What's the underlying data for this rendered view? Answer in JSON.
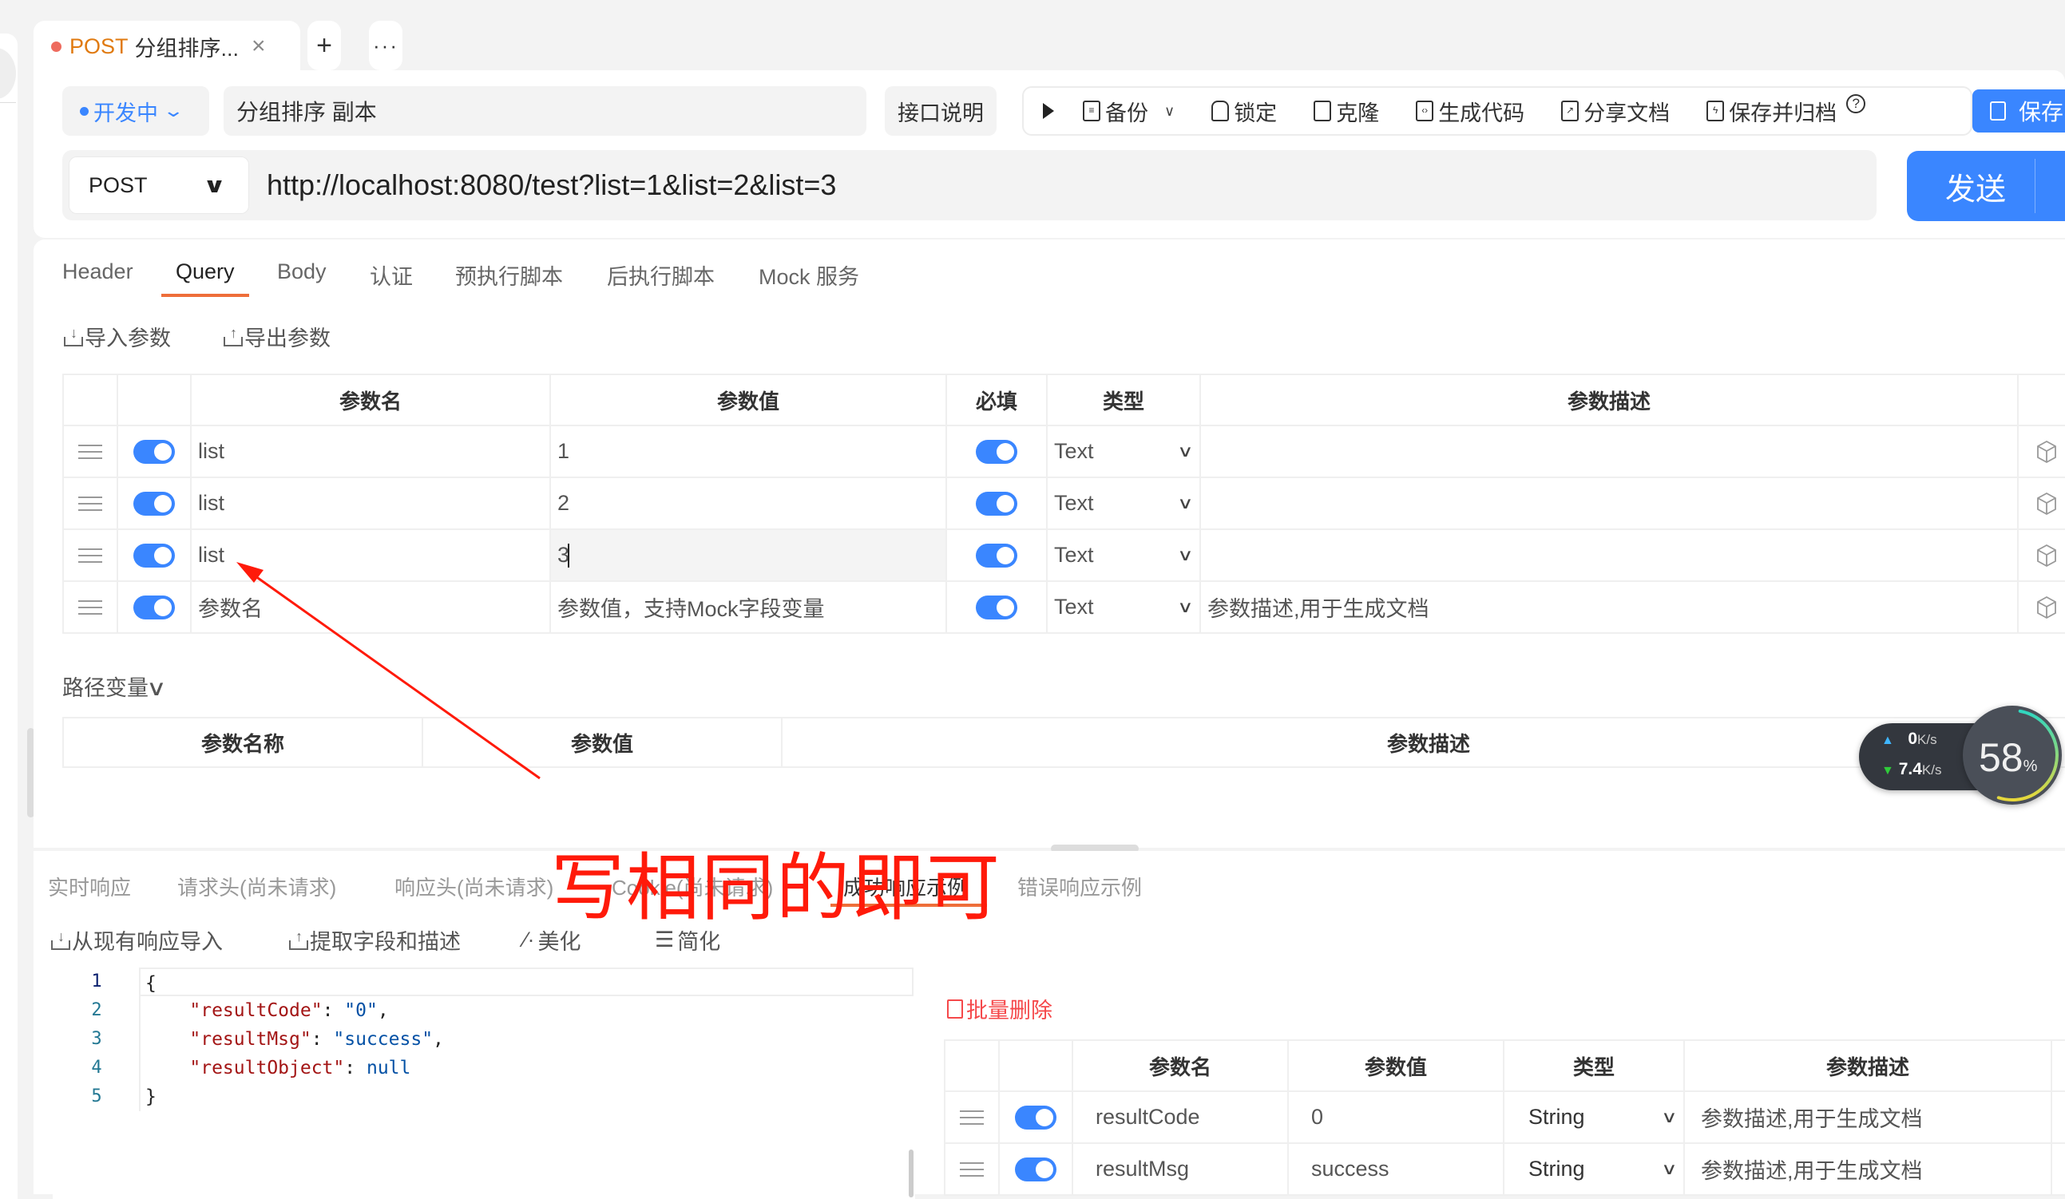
{
  "tab": {
    "method": "POST",
    "title": "分组排序...",
    "close_icon": "×",
    "add_label": "+",
    "more_label": "···"
  },
  "status": {
    "label": "开发中",
    "dot_color": "#3a86ff"
  },
  "api_name": "分组排序 副本",
  "doc_button": "接口说明",
  "toolbar": {
    "backup": "备份",
    "lock": "锁定",
    "clone": "克隆",
    "gen_code": "生成代码",
    "share_doc": "分享文档",
    "save_archive": "保存并归档",
    "help": "?",
    "save": "保存"
  },
  "request": {
    "method": "POST",
    "url": "http://localhost:8080/test?list=1&list=2&list=3",
    "send": "发送"
  },
  "param_tabs": [
    "Header",
    "Query",
    "Body",
    "认证",
    "预执行脚本",
    "后执行脚本",
    "Mock 服务"
  ],
  "param_tabs_active": "Query",
  "param_actions": {
    "import": "导入参数",
    "export": "导出参数"
  },
  "query_table": {
    "headers": {
      "name": "参数名",
      "value": "参数值",
      "required": "必填",
      "type": "类型",
      "desc": "参数描述"
    },
    "rows": [
      {
        "enabled": true,
        "name": "list",
        "value": "1",
        "required": true,
        "type": "Text",
        "desc": ""
      },
      {
        "enabled": true,
        "name": "list",
        "value": "2",
        "required": true,
        "type": "Text",
        "desc": ""
      },
      {
        "enabled": true,
        "name": "list",
        "value": "3",
        "required": true,
        "type": "Text",
        "desc": ""
      }
    ],
    "new_row": {
      "name_placeholder": "参数名",
      "value_placeholder": "参数值，支持Mock字段变量",
      "type": "Text",
      "desc_placeholder": "参数描述,用于生成文档"
    }
  },
  "path_vars": {
    "label": "路径变量",
    "headers": {
      "name": "参数名称",
      "value": "参数值",
      "desc": "参数描述"
    }
  },
  "annotation": {
    "text": "写相同的即可",
    "color": "#ff1a0a"
  },
  "net_monitor": {
    "upload": "0",
    "download": "7.4",
    "unit": "K/s",
    "cpu_percent": 58
  },
  "response_tabs": [
    "实时响应",
    "请求头(尚未请求)",
    "响应头(尚未请求)",
    "Cookie(尚未请求)",
    "成功响应示例",
    "错误响应示例"
  ],
  "response_tabs_active": "成功响应示例",
  "response_actions": {
    "import": "从现有响应导入",
    "extract": "提取字段和描述",
    "beautify": "美化",
    "simplify": "简化"
  },
  "editor": {
    "line_numbers": [
      "1",
      "2",
      "3",
      "4",
      "5"
    ],
    "lines": [
      {
        "indent": "",
        "key": "",
        "sep": "",
        "val": "",
        "tail": "{"
      },
      {
        "indent": "    ",
        "key": "\"resultCode\"",
        "sep": ": ",
        "val": "\"0\"",
        "tail": ","
      },
      {
        "indent": "    ",
        "key": "\"resultMsg\"",
        "sep": ": ",
        "val": "\"success\"",
        "tail": ","
      },
      {
        "indent": "    ",
        "key": "\"resultObject\"",
        "sep": ": ",
        "val": "null",
        "tail": ""
      },
      {
        "indent": "",
        "key": "",
        "sep": "",
        "val": "",
        "tail": "}"
      }
    ]
  },
  "bulk_delete": "批量删除",
  "response_table": {
    "headers": {
      "name": "参数名",
      "value": "参数值",
      "type": "类型",
      "desc": "参数描述"
    },
    "rows": [
      {
        "enabled": true,
        "name": "resultCode",
        "value": "0",
        "type": "String",
        "desc_placeholder": "参数描述,用于生成文档"
      },
      {
        "enabled": true,
        "name": "resultMsg",
        "value": "success",
        "type": "String",
        "desc_placeholder": "参数描述,用于生成文档"
      }
    ]
  }
}
